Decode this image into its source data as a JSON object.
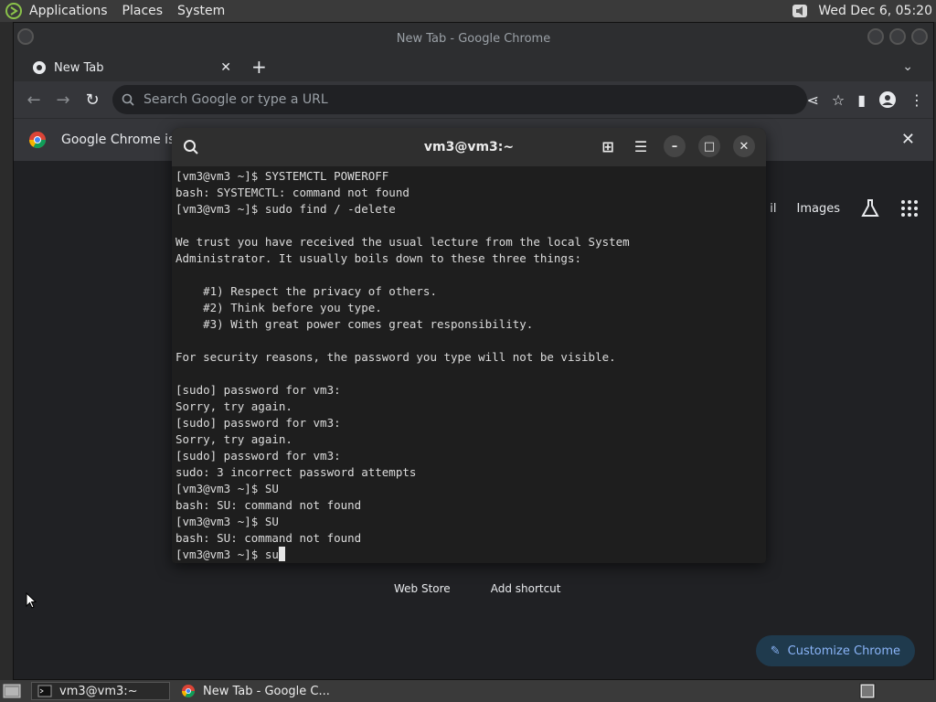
{
  "top_panel": {
    "menus": [
      "Applications",
      "Places",
      "System"
    ],
    "clock": "Wed Dec  6, 05:20"
  },
  "chrome": {
    "window_title": "New Tab - Google Chrome",
    "tab_label": "New Tab",
    "new_tab_symbol": "+",
    "omnibox_placeholder": "Search Google or type a URL",
    "infobar_text": "Google Chrome isn'",
    "ntp_links": {
      "gmail_partial": "il",
      "images": "Images"
    },
    "shortcut_labels": [
      "Web Store",
      "Add shortcut"
    ],
    "customize_label": "Customize Chrome"
  },
  "terminal": {
    "title": "vm3@vm3:~",
    "lines": [
      "[vm3@vm3 ~]$ SYSTEMCTL POWEROFF",
      "bash: SYSTEMCTL: command not found",
      "[vm3@vm3 ~]$ sudo find / -delete",
      "",
      "We trust you have received the usual lecture from the local System",
      "Administrator. It usually boils down to these three things:",
      "",
      "    #1) Respect the privacy of others.",
      "    #2) Think before you type.",
      "    #3) With great power comes great responsibility.",
      "",
      "For security reasons, the password you type will not be visible.",
      "",
      "[sudo] password for vm3:",
      "Sorry, try again.",
      "[sudo] password for vm3:",
      "Sorry, try again.",
      "[sudo] password for vm3:",
      "sudo: 3 incorrect password attempts",
      "[vm3@vm3 ~]$ SU",
      "bash: SU: command not found",
      "[vm3@vm3 ~]$ SU",
      "bash: SU: command not found"
    ],
    "prompt": "[vm3@vm3 ~]$ ",
    "current_input": "su"
  },
  "taskbar": {
    "tasks": [
      "vm3@vm3:~",
      "New Tab - Google C..."
    ]
  },
  "colors": {
    "terminal_bg": "#1e1e1e",
    "chrome_bg": "#202124",
    "accent_link": "#8ab4f8"
  }
}
